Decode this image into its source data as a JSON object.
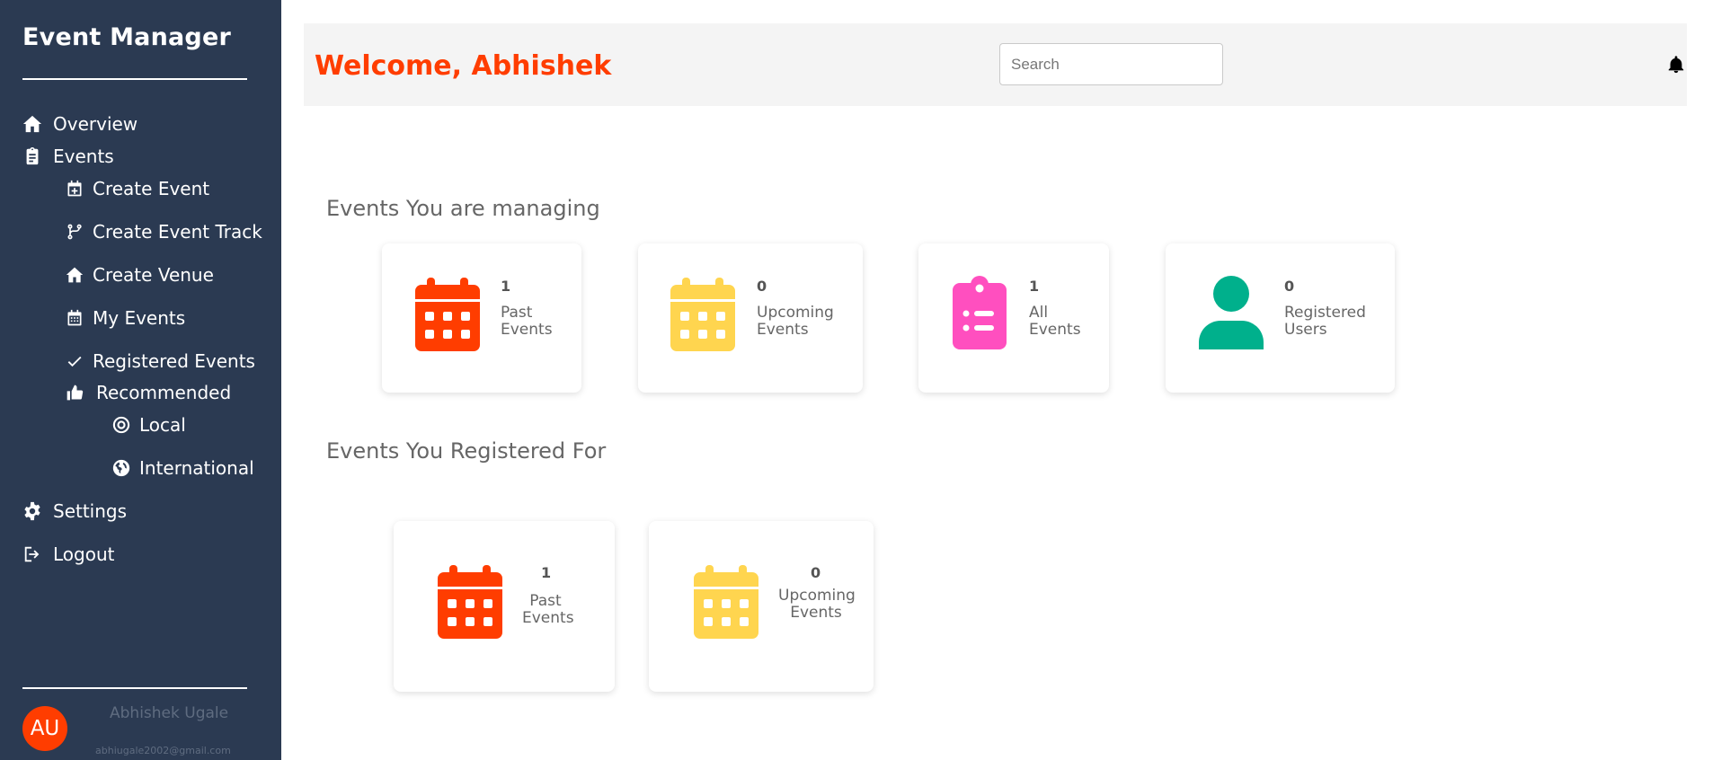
{
  "sidebar": {
    "brand": "Event Manager",
    "items": {
      "overview": "Overview",
      "events": "Events",
      "create_event": "Create Event",
      "create_event_track": "Create Event Track",
      "create_venue": "Create Venue",
      "my_events": "My Events",
      "registered_events": "Registered Events",
      "recommended": "Recommended",
      "local": "Local",
      "international": "International",
      "settings": "Settings",
      "logout": "Logout"
    },
    "user": {
      "initials": "AU",
      "name": "Abhishek Ugale",
      "email": "abhiugale2002@gmail.com"
    }
  },
  "header": {
    "welcome": "Welcome, Abhishek",
    "search_placeholder": "Search",
    "bell_icon": "bell-icon"
  },
  "managing": {
    "title": "Events You are managing",
    "cards": [
      {
        "count": "1",
        "line1": "Past",
        "line2": "Events",
        "icon": "calendar-icon",
        "color": "#ff3d00"
      },
      {
        "count": "0",
        "line1": "Upcoming",
        "line2": "Events",
        "icon": "calendar-icon",
        "color": "#ffd54f"
      },
      {
        "count": "1",
        "line1": "All",
        "line2": "Events",
        "icon": "clipboard-list-icon",
        "color": "#ff4fbf"
      },
      {
        "count": "0",
        "line1": "Registered",
        "line2": "Users",
        "icon": "user-icon",
        "color": "#00b08c"
      }
    ]
  },
  "registered": {
    "title": "Events You Registered For",
    "cards": [
      {
        "count": "1",
        "line1": "Past",
        "line2": "Events",
        "icon": "calendar-icon",
        "color": "#ff3d00"
      },
      {
        "count": "0",
        "line1": "Upcoming",
        "line2": "Events",
        "icon": "calendar-icon",
        "color": "#ffd54f"
      }
    ]
  }
}
